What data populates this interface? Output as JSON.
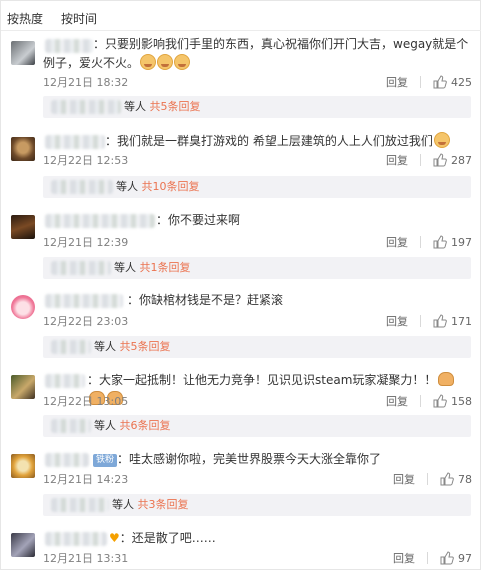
{
  "tabs": {
    "hot": "按热度",
    "time": "按时间"
  },
  "colors": {
    "link": "#eb7350",
    "meta": "#808080",
    "subbox_bg": "#f2f2f5"
  },
  "ui": {
    "reply": "回复",
    "sub_suffix": "等人",
    "separator": "："
  },
  "comments": [
    {
      "text": "只要别影响我们手里的东西，真心祝福你们开门大吉，wegay就是个例子，爱火不火。",
      "emoji_count": 3,
      "time": "12月21日 18:32",
      "likes": "425",
      "sub_more": "共5条回复"
    },
    {
      "text": "我们就是一群臭打游戏的 希望上层建筑的人上人们放过我们",
      "emoji_count": 1,
      "time": "12月22日 12:53",
      "likes": "287",
      "sub_more": "共10条回复"
    },
    {
      "text": "你不要过来啊",
      "emoji_count": 0,
      "time": "12月21日 12:39",
      "likes": "197",
      "sub_more": "共1条回复"
    },
    {
      "text": "你缺棺材钱是不是？赶紧滚",
      "emoji_count": 0,
      "time": "12月22日 23:03",
      "likes": "171",
      "sub_more": "共5条回复"
    },
    {
      "text": "大家一起抵制！让他无力竞争！见识见识steam玩家凝聚力！！",
      "emoji_count": 0,
      "hands": 3,
      "time": "12月22日 13:05",
      "likes": "158",
      "sub_more": "共6条回复"
    },
    {
      "badge": "铁粉",
      "text": "哇太感谢你啦，完美世界股票今天大涨全靠你了",
      "emoji_count": 0,
      "time": "12月21日 14:23",
      "likes": "78",
      "sub_more": "共3条回复"
    },
    {
      "heart": "♥",
      "text": "还是散了吧……",
      "emoji_count": 0,
      "time": "12月21日 13:31",
      "likes": "97",
      "sub_more": ""
    }
  ]
}
